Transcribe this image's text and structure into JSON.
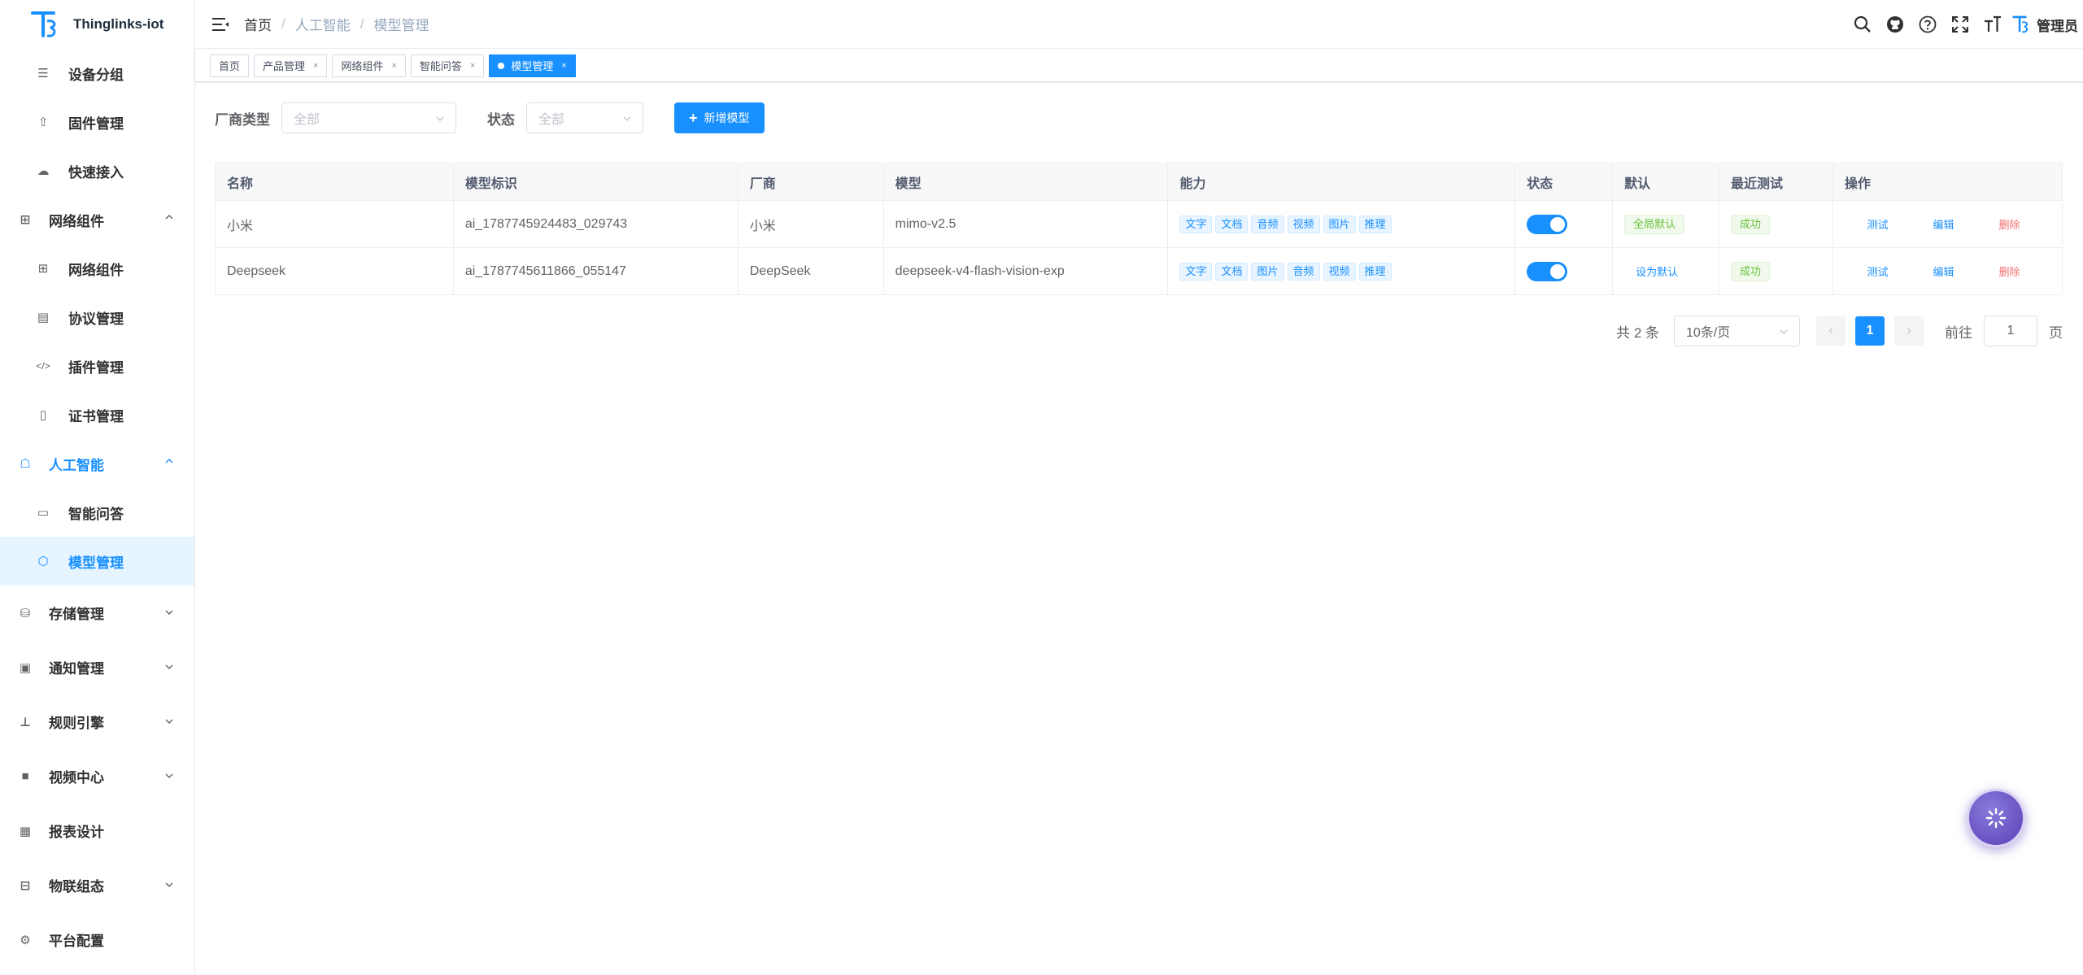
{
  "app": {
    "title": "Thinglinks-iot"
  },
  "sidebar": {
    "items": [
      {
        "label": "设备分组",
        "icon": "list-icon"
      },
      {
        "label": "固件管理",
        "icon": "upload-icon"
      },
      {
        "label": "快速接入",
        "icon": "cloud-icon"
      },
      {
        "label": "网络组件",
        "icon": "network-icon"
      },
      {
        "label": "网络组件",
        "icon": "network-icon"
      },
      {
        "label": "协议管理",
        "icon": "document-icon"
      },
      {
        "label": "插件管理",
        "icon": "code-icon"
      },
      {
        "label": "证书管理",
        "icon": "certificate-icon"
      },
      {
        "label": "人工智能",
        "icon": "robot-icon"
      },
      {
        "label": "智能问答",
        "icon": "chat-icon"
      },
      {
        "label": "模型管理",
        "icon": "cube-icon"
      },
      {
        "label": "存储管理",
        "icon": "database-icon"
      },
      {
        "label": "通知管理",
        "icon": "message-icon"
      },
      {
        "label": "规则引擎",
        "icon": "tree-icon"
      },
      {
        "label": "视频中心",
        "icon": "video-icon"
      },
      {
        "label": "报表设计",
        "icon": "report-icon"
      },
      {
        "label": "物联组态",
        "icon": "grid-icon"
      },
      {
        "label": "平台配置",
        "icon": "settings-icon"
      }
    ]
  },
  "header": {
    "breadcrumb": [
      "首页",
      "人工智能",
      "模型管理"
    ],
    "user": "管理员"
  },
  "tags": [
    {
      "label": "首页"
    },
    {
      "label": "产品管理"
    },
    {
      "label": "网络组件"
    },
    {
      "label": "智能问答"
    },
    {
      "label": "模型管理"
    }
  ],
  "filters": {
    "vendor_label": "厂商类型",
    "vendor_value": "全部",
    "status_label": "状态",
    "status_value": "全部",
    "add_button": "新增模型"
  },
  "table": {
    "columns": [
      "名称",
      "模型标识",
      "厂商",
      "模型",
      "能力",
      "状态",
      "默认",
      "最近测试",
      "操作"
    ],
    "rows": [
      {
        "name": "小米",
        "identifier": "ai_1787745924483_029743",
        "vendor": "小米",
        "model": "mimo-v2.5",
        "capabilities": [
          "文字",
          "文档",
          "音频",
          "视频",
          "图片",
          "推理"
        ],
        "enabled": true,
        "default": "全局默认",
        "last_test": "成功",
        "actions": [
          "测试",
          "编辑",
          "删除"
        ]
      },
      {
        "name": "Deepseek",
        "identifier": "ai_1787745611866_055147",
        "vendor": "DeepSeek",
        "model": "deepseek-v4-flash-vision-exp",
        "capabilities": [
          "文字",
          "文档",
          "图片",
          "音频",
          "视频",
          "推理"
        ],
        "enabled": true,
        "default": "设为默认",
        "last_test": "成功",
        "actions": [
          "测试",
          "编辑",
          "删除"
        ]
      }
    ]
  },
  "pagination": {
    "total": "共 2 条",
    "page_size": "10条/页",
    "current_page": "1",
    "goto_label": "前往",
    "goto_value": "1",
    "page_suffix": "页"
  },
  "colors": {
    "primary": "#1890ff",
    "danger": "#f56c6c",
    "success": "#67c23a"
  }
}
